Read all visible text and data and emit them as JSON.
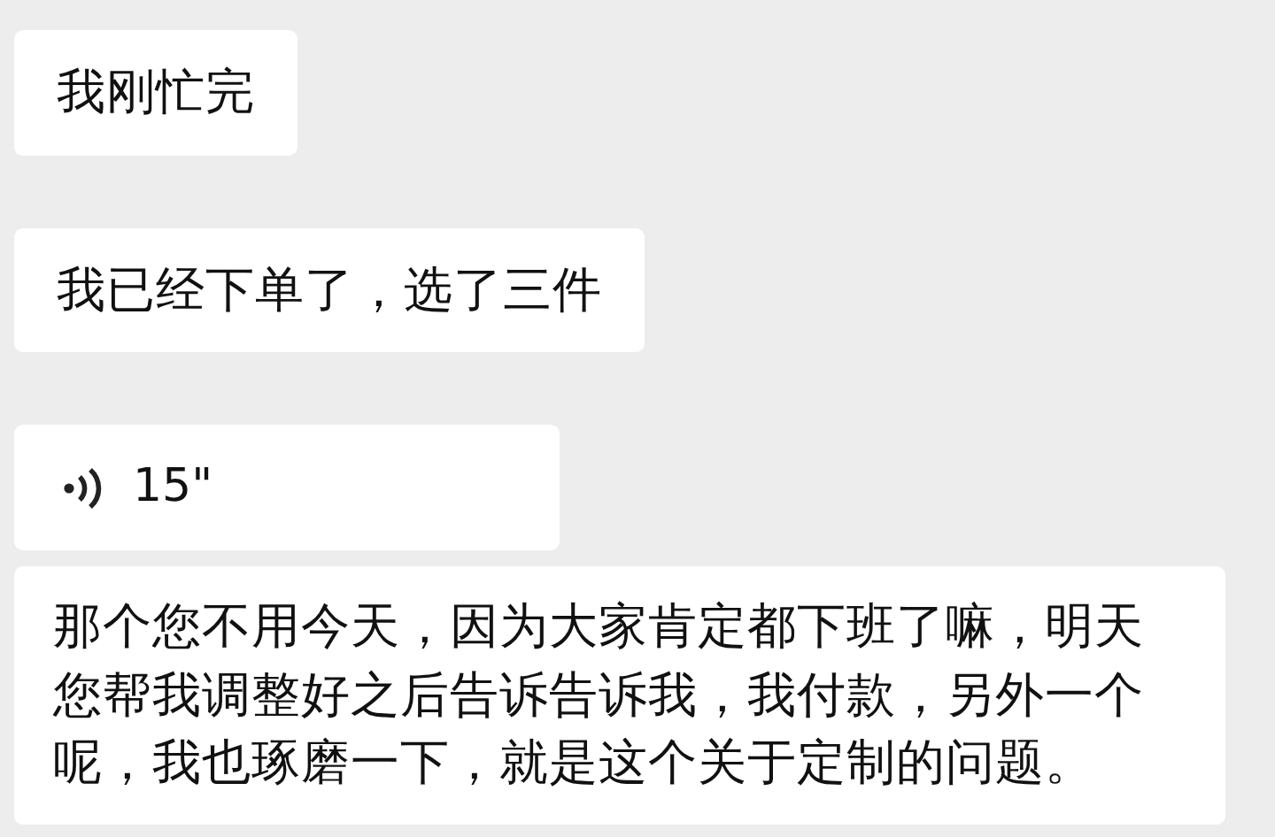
{
  "messages": [
    {
      "kind": "text",
      "text": "我刚忙完"
    },
    {
      "kind": "text",
      "text": "我已经下单了，选了三件"
    },
    {
      "kind": "voice",
      "duration": "15\""
    },
    {
      "kind": "text",
      "text": "那个您不用今天，因为大家肯定都下班了嘛，明天您帮我调整好之后告诉告诉我，我付款，另外一个呢，我也琢磨一下，就是这个关于定制的问题。"
    }
  ]
}
